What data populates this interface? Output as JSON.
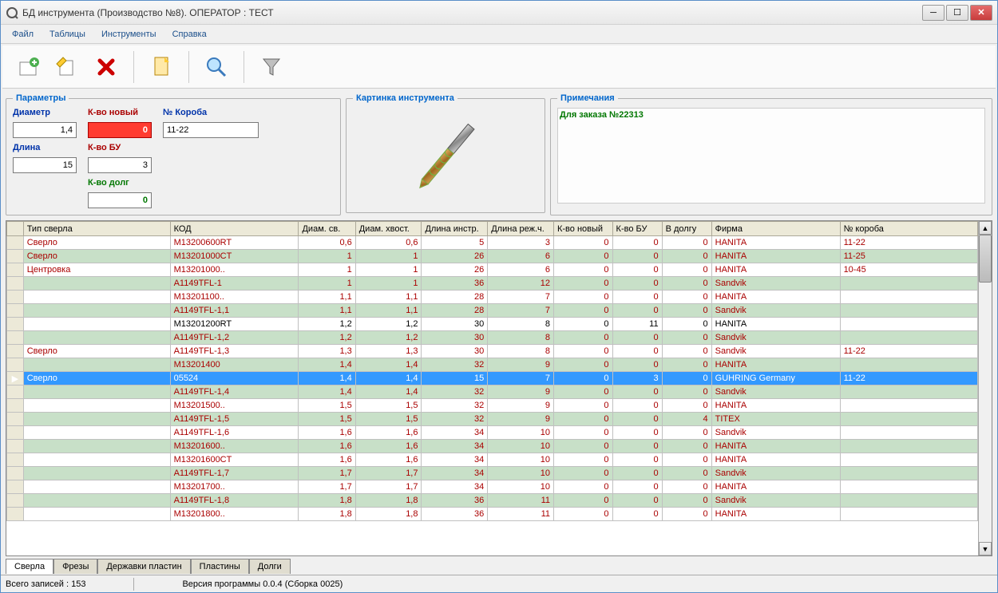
{
  "window": {
    "title": "БД инструмента (Производство №8). ОПЕРАТОР : ТЕСТ"
  },
  "menu": {
    "file": "Файл",
    "tables": "Таблицы",
    "tools": "Инструменты",
    "help": "Справка"
  },
  "panels": {
    "params_legend": "Параметры",
    "diameter_label": "Диаметр",
    "diameter": "1,4",
    "length_label": "Длина",
    "length": "15",
    "qty_new_label": "К-во новый",
    "qty_new": "0",
    "qty_used_label": "К-во БУ",
    "qty_used": "3",
    "qty_debt_label": "К-во долг",
    "qty_debt": "0",
    "box_label": "№ Короба",
    "box": "11-22",
    "picture_legend": "Картинка инструмента",
    "notes_legend": "Примечания",
    "notes_text": "Для заказа №22313"
  },
  "grid": {
    "headers": [
      "Тип сверла",
      "КОД",
      "Диам. св.",
      "Диам. хвост.",
      "Длина инстр.",
      "Длина реж.ч.",
      "К-во новый",
      "К-во БУ",
      "В долгу",
      "Фирма",
      "№ короба"
    ],
    "rows": [
      {
        "sel": false,
        "alt": 0,
        "red": 1,
        "c": [
          "Сверло",
          "M13200600RT",
          "0,6",
          "0,6",
          "5",
          "3",
          "0",
          "0",
          "0",
          "HANITA",
          "11-22"
        ]
      },
      {
        "sel": false,
        "alt": 1,
        "red": 1,
        "c": [
          "Сверло",
          "M13201000CT",
          "1",
          "1",
          "26",
          "6",
          "0",
          "0",
          "0",
          "HANITA",
          "11-25"
        ]
      },
      {
        "sel": false,
        "alt": 0,
        "red": 1,
        "c": [
          "Центровка",
          "M13201000..",
          "1",
          "1",
          "26",
          "6",
          "0",
          "0",
          "0",
          "HANITA",
          "10-45"
        ]
      },
      {
        "sel": false,
        "alt": 1,
        "red": 1,
        "c": [
          "",
          "A1149TFL-1",
          "1",
          "1",
          "36",
          "12",
          "0",
          "0",
          "0",
          "Sandvik",
          ""
        ]
      },
      {
        "sel": false,
        "alt": 0,
        "red": 1,
        "c": [
          "",
          "M13201100..",
          "1,1",
          "1,1",
          "28",
          "7",
          "0",
          "0",
          "0",
          "HANITA",
          ""
        ]
      },
      {
        "sel": false,
        "alt": 1,
        "red": 1,
        "c": [
          "",
          "A1149TFL-1,1",
          "1,1",
          "1,1",
          "28",
          "7",
          "0",
          "0",
          "0",
          "Sandvik",
          ""
        ]
      },
      {
        "sel": false,
        "alt": 0,
        "red": 0,
        "c": [
          "",
          "M13201200RT",
          "1,2",
          "1,2",
          "30",
          "8",
          "0",
          "11",
          "0",
          "HANITA",
          ""
        ]
      },
      {
        "sel": false,
        "alt": 1,
        "red": 1,
        "c": [
          "",
          "A1149TFL-1,2",
          "1,2",
          "1,2",
          "30",
          "8",
          "0",
          "0",
          "0",
          "Sandvik",
          ""
        ]
      },
      {
        "sel": false,
        "alt": 0,
        "red": 1,
        "c": [
          "Сверло",
          "A1149TFL-1,3",
          "1,3",
          "1,3",
          "30",
          "8",
          "0",
          "0",
          "0",
          "Sandvik",
          "11-22"
        ]
      },
      {
        "sel": false,
        "alt": 1,
        "red": 1,
        "c": [
          "",
          "M13201400",
          "1,4",
          "1,4",
          "32",
          "9",
          "0",
          "0",
          "0",
          "HANITA",
          ""
        ]
      },
      {
        "sel": true,
        "alt": 0,
        "red": 0,
        "c": [
          "Сверло",
          "05524",
          "1,4",
          "1,4",
          "15",
          "7",
          "0",
          "3",
          "0",
          "GUHRING    Germany",
          "11-22"
        ]
      },
      {
        "sel": false,
        "alt": 1,
        "red": 1,
        "c": [
          "",
          "A1149TFL-1,4",
          "1,4",
          "1,4",
          "32",
          "9",
          "0",
          "0",
          "0",
          "Sandvik",
          ""
        ]
      },
      {
        "sel": false,
        "alt": 0,
        "red": 1,
        "c": [
          "",
          "M13201500..",
          "1,5",
          "1,5",
          "32",
          "9",
          "0",
          "0",
          "0",
          "HANITA",
          ""
        ]
      },
      {
        "sel": false,
        "alt": 1,
        "red": 1,
        "c": [
          "",
          "A1149TFL-1,5",
          "1,5",
          "1,5",
          "32",
          "9",
          "0",
          "0",
          "4",
          "TITEX",
          ""
        ]
      },
      {
        "sel": false,
        "alt": 0,
        "red": 1,
        "c": [
          "",
          "A1149TFL-1,6",
          "1,6",
          "1,6",
          "34",
          "10",
          "0",
          "0",
          "0",
          "Sandvik",
          ""
        ]
      },
      {
        "sel": false,
        "alt": 1,
        "red": 1,
        "c": [
          "",
          "M13201600..",
          "1,6",
          "1,6",
          "34",
          "10",
          "0",
          "0",
          "0",
          "HANITA",
          ""
        ]
      },
      {
        "sel": false,
        "alt": 0,
        "red": 1,
        "c": [
          "",
          "M13201600CT",
          "1,6",
          "1,6",
          "34",
          "10",
          "0",
          "0",
          "0",
          "HANITA",
          ""
        ]
      },
      {
        "sel": false,
        "alt": 1,
        "red": 1,
        "c": [
          "",
          "A1149TFL-1,7",
          "1,7",
          "1,7",
          "34",
          "10",
          "0",
          "0",
          "0",
          "Sandvik",
          ""
        ]
      },
      {
        "sel": false,
        "alt": 0,
        "red": 1,
        "c": [
          "",
          "M13201700..",
          "1,7",
          "1,7",
          "34",
          "10",
          "0",
          "0",
          "0",
          "HANITA",
          ""
        ]
      },
      {
        "sel": false,
        "alt": 1,
        "red": 1,
        "c": [
          "",
          "A1149TFL-1,8",
          "1,8",
          "1,8",
          "36",
          "11",
          "0",
          "0",
          "0",
          "Sandvik",
          ""
        ]
      },
      {
        "sel": false,
        "alt": 0,
        "red": 1,
        "c": [
          "",
          "M13201800..",
          "1,8",
          "1,8",
          "36",
          "11",
          "0",
          "0",
          "0",
          "HANITA",
          ""
        ]
      }
    ]
  },
  "tabs": [
    "Сверла",
    "Фрезы",
    "Державки пластин",
    "Пластины",
    "Долги"
  ],
  "status": {
    "records": "Всего записей : 153",
    "version": "Версия программы 0.0.4    (Сборка 0025)"
  }
}
